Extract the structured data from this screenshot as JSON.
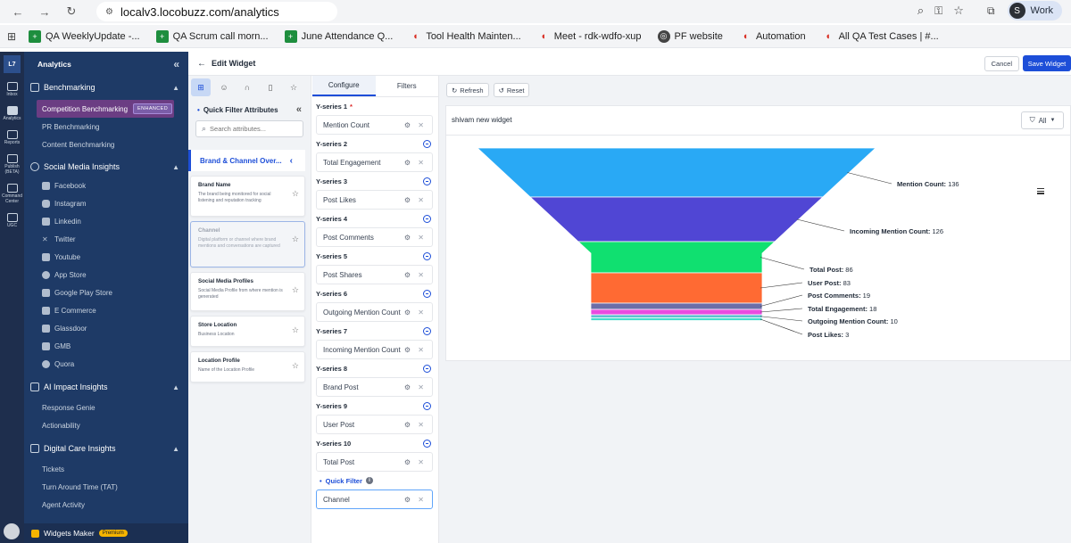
{
  "browser": {
    "url": "localv3.locobuzz.com/analytics",
    "profile_initial": "S",
    "profile_name": "Work",
    "bookmarks": [
      {
        "label": "QA WeeklyUpdate -...",
        "icon": "sheets-icon",
        "color": "#1e8e3e"
      },
      {
        "label": "QA Scrum call morn...",
        "icon": "sheets-icon",
        "color": "#1e8e3e"
      },
      {
        "label": "June Attendance Q...",
        "icon": "sheets-icon",
        "color": "#1e8e3e"
      },
      {
        "label": "Tool Health Mainten...",
        "icon": "pin-icon",
        "color": "#d93025"
      },
      {
        "label": "Meet - rdk-wdfo-xup",
        "icon": "pin-icon",
        "color": "#d93025"
      },
      {
        "label": "PF website",
        "icon": "globe-icon",
        "color": "#444444"
      },
      {
        "label": "Automation",
        "icon": "pin-icon",
        "color": "#d93025"
      },
      {
        "label": "All QA Test Cases | #...",
        "icon": "pin-icon",
        "color": "#d93025"
      }
    ]
  },
  "rail": {
    "logo": "L7",
    "items": [
      {
        "label": "Inbox"
      },
      {
        "label": "Analytics"
      },
      {
        "label": "Reports"
      },
      {
        "label": "Publish (BETA)"
      },
      {
        "label": "Command Center"
      },
      {
        "label": "UGC"
      }
    ]
  },
  "sidebar": {
    "title": "Analytics",
    "benchmarking": {
      "label": "Benchmarking",
      "items": [
        {
          "label": "Competition Benchmarking",
          "badge": "ENHANCED"
        },
        {
          "label": "PR Benchmarking"
        },
        {
          "label": "Content Benchmarking"
        }
      ]
    },
    "social": {
      "label": "Social Media Insights",
      "items": [
        "Facebook",
        "Instagram",
        "Linkedin",
        "Twitter",
        "Youtube",
        "App Store",
        "Google Play Store",
        "E Commerce",
        "Glassdoor",
        "GMB",
        "Quora"
      ]
    },
    "ai": {
      "label": "AI Impact Insights",
      "items": [
        "Response Genie",
        "Actionability"
      ]
    },
    "care": {
      "label": "Digital Care Insights",
      "items": [
        "Tickets",
        "Turn Around Time (TAT)",
        "Agent Activity"
      ]
    },
    "widgets_maker": {
      "label": "Widgets Maker",
      "badge": "Premium"
    }
  },
  "editbar": {
    "title": "Edit Widget",
    "cancel": "Cancel",
    "save": "Save Widget"
  },
  "attributes": {
    "header": "Quick Filter Attributes",
    "search_placeholder": "Search attributes...",
    "group": "Brand & Channel Over...",
    "cards": [
      {
        "title": "Brand Name",
        "desc": "The brand being monitored for social listening and reputation tracking"
      },
      {
        "title": "Channel",
        "desc": "Digital platform or channel where brand mentions and conversations are captured"
      },
      {
        "title": "Social Media Profiles",
        "desc": "Social Media Profile from where mention is generated"
      },
      {
        "title": "Store Location",
        "desc": "Business Location"
      },
      {
        "title": "Location Profile",
        "desc": "Name of the Location Profile"
      }
    ]
  },
  "configure": {
    "tabs": [
      "Configure",
      "Filters"
    ],
    "series": [
      {
        "label": "Y-series 1",
        "value": "Mention Count"
      },
      {
        "label": "Y-series 2",
        "value": "Total Engagement"
      },
      {
        "label": "Y-series 3",
        "value": "Post Likes"
      },
      {
        "label": "Y-series 4",
        "value": "Post Comments"
      },
      {
        "label": "Y-series 5",
        "value": "Post Shares"
      },
      {
        "label": "Y-series 6",
        "value": "Outgoing Mention Count"
      },
      {
        "label": "Y-series 7",
        "value": "Incoming Mention Count"
      },
      {
        "label": "Y-series 8",
        "value": "Brand Post"
      },
      {
        "label": "Y-series 9",
        "value": "User Post"
      },
      {
        "label": "Y-series 10",
        "value": "Total Post"
      }
    ],
    "quick_filter_label": "Quick Filter",
    "quick_filter_value": "Channel"
  },
  "preview": {
    "refresh": "Refresh",
    "reset": "Reset",
    "widget_title": "shivam new widget",
    "filter": "All"
  },
  "chart_data": {
    "type": "funnel",
    "series": [
      {
        "name": "Mention Count",
        "value": 136,
        "color": "#29a9f5"
      },
      {
        "name": "Incoming Mention Count",
        "value": 126,
        "color": "#5046d4"
      },
      {
        "name": "Total Post",
        "value": 86,
        "color": "#10e070"
      },
      {
        "name": "User Post",
        "value": 83,
        "color": "#ff6a33"
      },
      {
        "name": "Post Comments",
        "value": 19,
        "color": "#6c6ea8"
      },
      {
        "name": "Total Engagement",
        "value": 18,
        "color": "#e94ae0"
      },
      {
        "name": "Outgoing Mention Count",
        "value": 10,
        "color": "#60c0d0"
      },
      {
        "name": "Post Likes",
        "value": 3,
        "color": "#44dccb"
      }
    ]
  }
}
